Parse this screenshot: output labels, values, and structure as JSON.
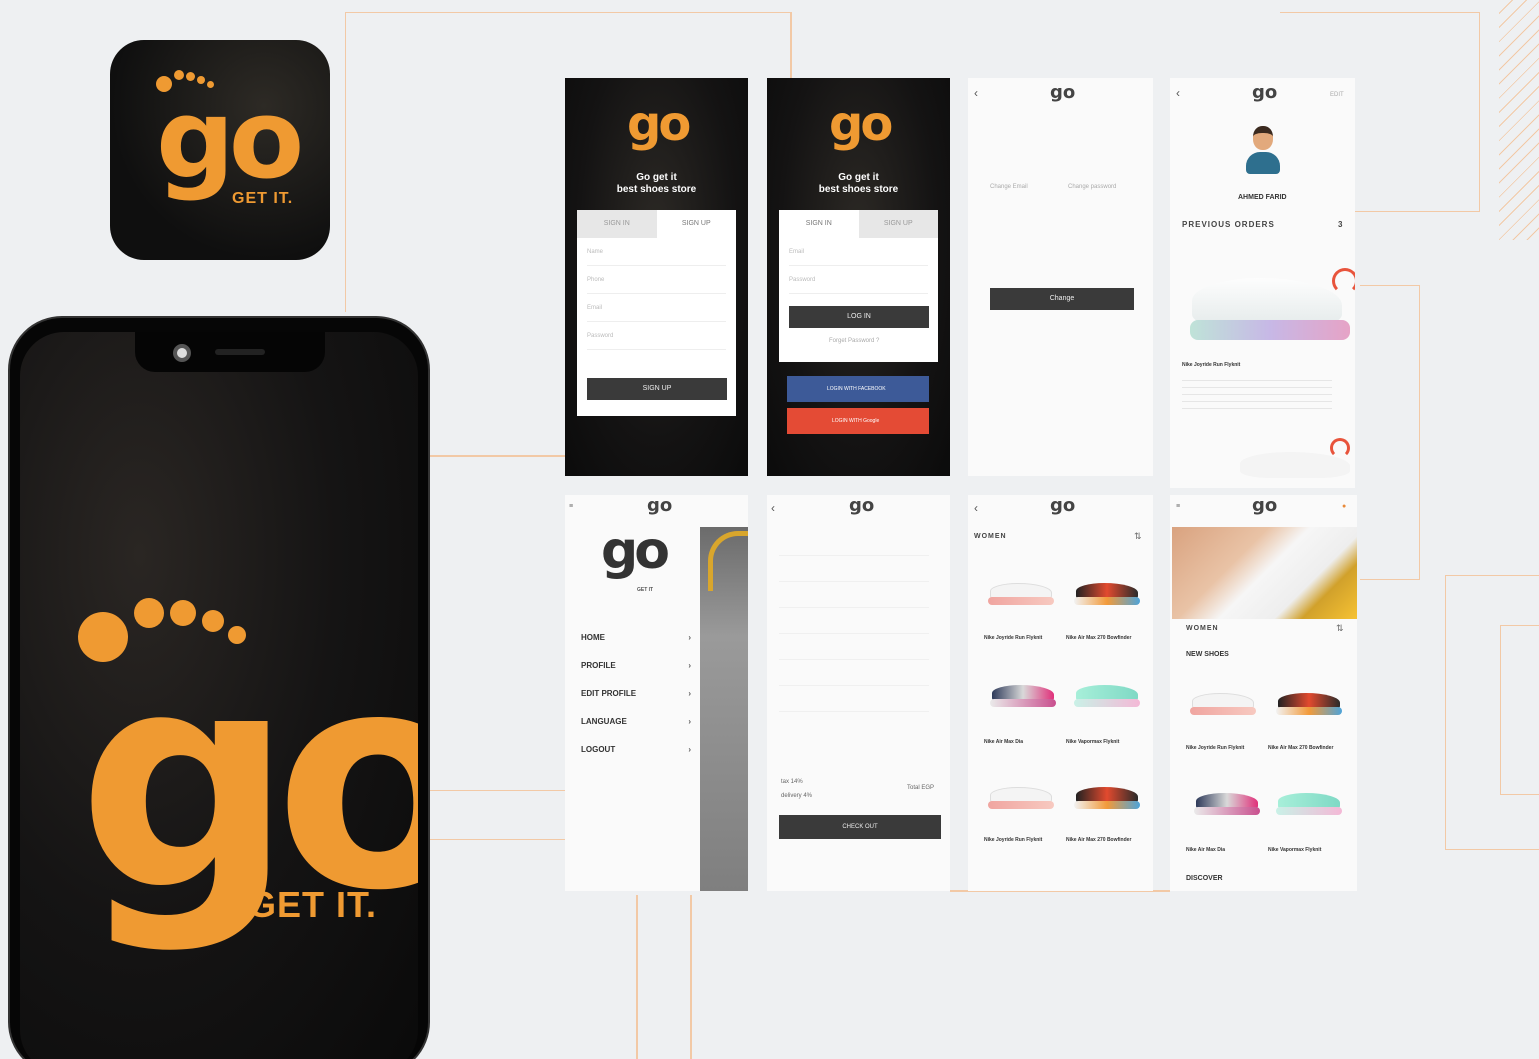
{
  "brand": {
    "logo_text": "go",
    "tagline": "GET IT.",
    "tagline_small": "GET IT",
    "subtitle_line1": "Go get it",
    "subtitle_line2": "best shoes store",
    "accent": "#ef9a32"
  },
  "signup_screen": {
    "tab_signin": "SIGN IN",
    "tab_signup": "SIGN UP",
    "field_name": "Name",
    "field_phone": "Phone",
    "field_email": "Email",
    "field_password": "Password",
    "submit": "SIGN UP"
  },
  "login_screen": {
    "tab_signin": "SIGN IN",
    "tab_signup": "SIGN UP",
    "field_email": "Email",
    "field_password": "Password",
    "submit": "LOG IN",
    "forgot": "Forget Password ?",
    "facebook": "LOGIN WITH FACEBOOK",
    "google": "LOGIN WITH Google"
  },
  "change_screen": {
    "tab_email": "Change Email",
    "tab_password": "Change password",
    "button": "Change"
  },
  "profile_screen": {
    "edit": "EDIT",
    "user_name": "AHMED FARID",
    "section": "PREVIOUS ORDERS",
    "count": "3",
    "product_name": "Nike Joyride Run Flyknit"
  },
  "menu_screen": {
    "items": [
      {
        "label": "HOME"
      },
      {
        "label": "PROFILE"
      },
      {
        "label": "EDIT PROFILE"
      },
      {
        "label": "LANGUAGE"
      },
      {
        "label": "LOGOUT"
      }
    ]
  },
  "checkout_screen": {
    "tax_label": "tax 14%",
    "delivery_label": "delivery 4%",
    "total": "Total EGP",
    "button": "CHECK OUT"
  },
  "women_screen": {
    "header": "WOMEN",
    "products": [
      {
        "name": "Nike Joyride Run Flyknit"
      },
      {
        "name": "Nike Air Max 270 Bowfinder"
      },
      {
        "name": "Nike Air Max Dia"
      },
      {
        "name": "Nike Vapormax Flyknit"
      },
      {
        "name": "Nike Joyride Run Flyknit"
      },
      {
        "name": "Nike Air Max 270 Bowfinder"
      }
    ]
  },
  "home_screen": {
    "header": "WOMEN",
    "section_new": "NEW SHOES",
    "section_discover": "DISCOVER",
    "products": [
      {
        "name": "Nike Joyride Run Flyknit"
      },
      {
        "name": "Nike Air Max 270 Bowfinder"
      },
      {
        "name": "Nike Air Max Dia"
      },
      {
        "name": "Nike Vapormax Flyknit"
      }
    ]
  }
}
